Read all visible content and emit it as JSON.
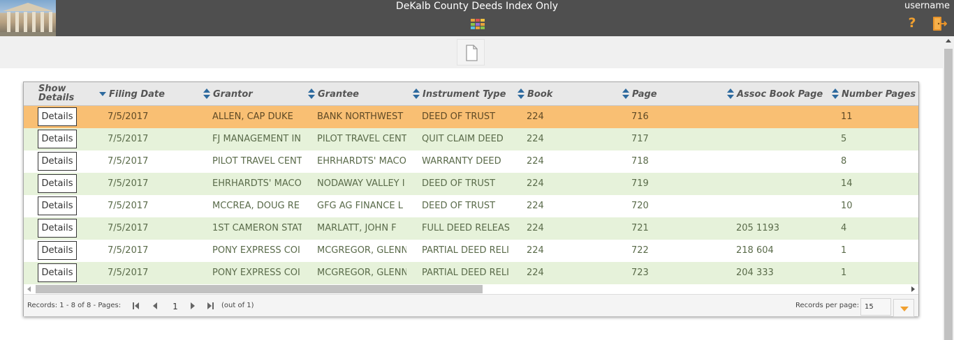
{
  "header": {
    "title": "DeKalb County Deeds Index Only",
    "username": "username",
    "help_label": "?",
    "icons": [
      "courthouse-logo",
      "apps-grid-icon",
      "help-icon",
      "exit-icon"
    ],
    "grid_icon_colors": [
      "#e8a33c",
      "#d9534f",
      "#f0c040",
      "#8bc34a",
      "#9c6bd6",
      "#e8a33c",
      "#5bc0de",
      "#e8a33c",
      "#8bc34a"
    ]
  },
  "toolbar": {
    "document_icon": "document-icon"
  },
  "grid": {
    "columns": {
      "show_details_line1": "Show",
      "show_details_line2": "Details",
      "filing_date": "Filing Date",
      "grantor": "Grantor",
      "grantee": "Grantee",
      "instrument_type": "Instrument Type",
      "book": "Book",
      "page": "Page",
      "assoc_book_page": "Assoc Book Page",
      "number_pages": "Number Pages"
    },
    "details_label": "Details",
    "rows": [
      {
        "filing_date": "7/5/2017",
        "grantor": "ALLEN, CAP DUKE",
        "grantee": "BANK NORTHWEST",
        "instrument_type": "DEED OF TRUST",
        "book": "224",
        "page": "716",
        "assoc": "",
        "num_pages": "11"
      },
      {
        "filing_date": "7/5/2017",
        "grantor": "FJ MANAGEMENT IN",
        "grantee": "PILOT TRAVEL CENT",
        "instrument_type": "QUIT CLAIM DEED",
        "book": "224",
        "page": "717",
        "assoc": "",
        "num_pages": "5"
      },
      {
        "filing_date": "7/5/2017",
        "grantor": "PILOT TRAVEL CENT",
        "grantee": "EHRHARDTS' MACO",
        "instrument_type": "WARRANTY DEED",
        "book": "224",
        "page": "718",
        "assoc": "",
        "num_pages": "8"
      },
      {
        "filing_date": "7/5/2017",
        "grantor": "EHRHARDTS' MACO",
        "grantee": "NODAWAY VALLEY I",
        "instrument_type": "DEED OF TRUST",
        "book": "224",
        "page": "719",
        "assoc": "",
        "num_pages": "14"
      },
      {
        "filing_date": "7/5/2017",
        "grantor": "MCCREA, DOUG RE",
        "grantee": "GFG AG FINANCE L",
        "instrument_type": "DEED OF TRUST",
        "book": "224",
        "page": "720",
        "assoc": "",
        "num_pages": "10"
      },
      {
        "filing_date": "7/5/2017",
        "grantor": "1ST CAMERON STAT",
        "grantee": "MARLATT, JOHN F",
        "instrument_type": "FULL DEED RELEAS",
        "book": "224",
        "page": "721",
        "assoc": "205 1193",
        "num_pages": "4"
      },
      {
        "filing_date": "7/5/2017",
        "grantor": "PONY EXPRESS COI",
        "grantee": "MCGREGOR, GLENN",
        "instrument_type": "PARTIAL DEED RELI",
        "book": "224",
        "page": "722",
        "assoc": "218 604",
        "num_pages": "1"
      },
      {
        "filing_date": "7/5/2017",
        "grantor": "PONY EXPRESS COI",
        "grantee": "MCGREGOR, GLENN",
        "instrument_type": "PARTIAL DEED RELI",
        "book": "224",
        "page": "723",
        "assoc": "204 333",
        "num_pages": "1"
      }
    ],
    "selected_row_color": "#f9bf73",
    "alt_row_color": "#e6f2da"
  },
  "pager": {
    "records_text": "Records: 1 - 8 of 8 - Pages:",
    "current_page": "1",
    "out_of_text": "(out of 1)",
    "records_per_page_label": "Records per page:",
    "records_per_page_value": "15",
    "accent_color": "#f0a030"
  }
}
